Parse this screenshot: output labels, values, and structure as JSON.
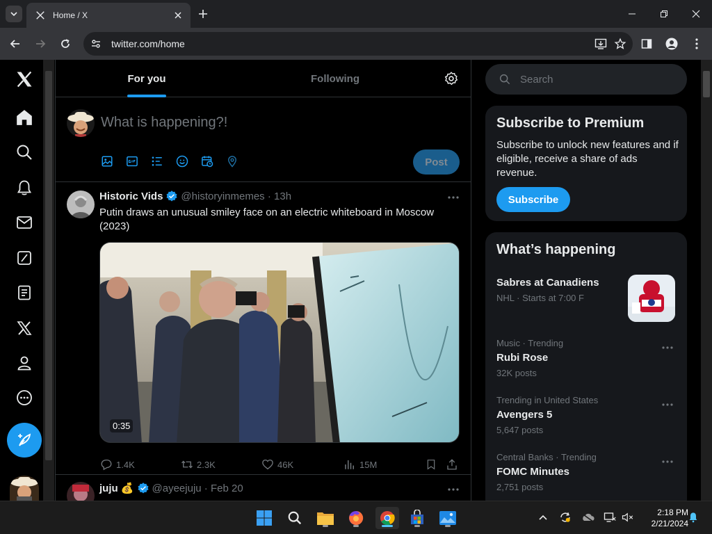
{
  "browser": {
    "tab_title": "Home / X",
    "url": "twitter.com/home"
  },
  "feed_tabs": [
    "For you",
    "Following"
  ],
  "composer": {
    "placeholder": "What is happening?!",
    "post_label": "Post"
  },
  "tweets": [
    {
      "name": "Historic Vids",
      "handle": "@historyinmemes",
      "time": "13h",
      "text": "Putin draws an unusual smiley face on an electric whiteboard in Moscow (2023)",
      "video_duration": "0:35",
      "replies": "1.4K",
      "reposts": "2.3K",
      "likes": "46K",
      "views": "15M"
    },
    {
      "name": "juju 💰",
      "handle": "@ayeejuju",
      "time": "Feb 20"
    }
  ],
  "sidebar": {
    "search_placeholder": "Search",
    "premium": {
      "title": "Subscribe to Premium",
      "text": "Subscribe to unlock new features and if eligible, receive a share of ads revenue.",
      "button": "Subscribe"
    },
    "whats_happening": {
      "title": "What’s happening",
      "trends": [
        {
          "meta": "",
          "title": "Sabres at Canadiens",
          "count": "NHL · Starts at 7:00 F",
          "has_thumb": true
        },
        {
          "meta": "Music · Trending",
          "title": "Rubi Rose",
          "count": "32K posts"
        },
        {
          "meta": "Trending in United States",
          "title": "Avengers 5",
          "count": "5,647 posts"
        },
        {
          "meta": "Central Banks · Trending",
          "title": "FOMC Minutes",
          "count": "2,751 posts"
        }
      ]
    }
  },
  "taskbar": {
    "time": "2:18 PM",
    "date": "2/21/2024"
  },
  "colors": {
    "accent": "#1d9bf0",
    "background": "#000000",
    "card": "#16181c",
    "border": "#2f3336",
    "muted_text": "#71767b"
  }
}
